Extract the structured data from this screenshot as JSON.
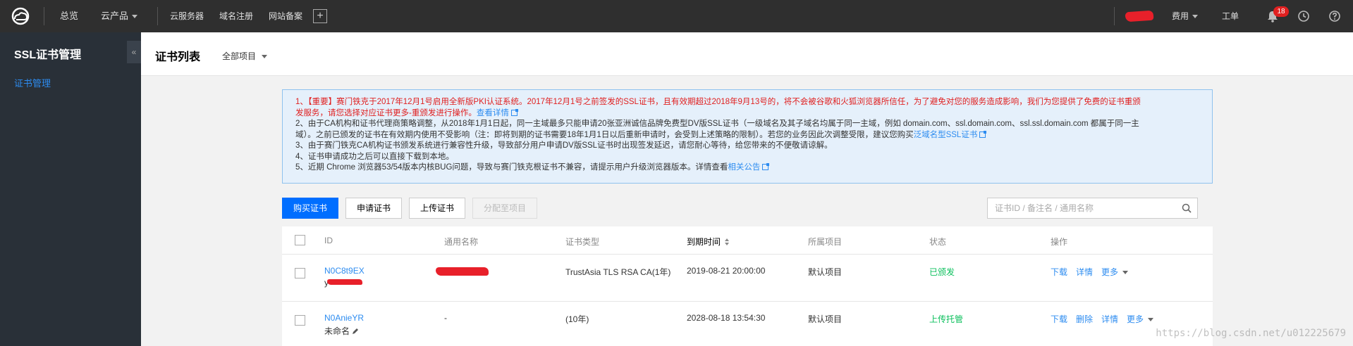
{
  "topbar": {
    "nav": {
      "overview": "总览",
      "products": "云产品",
      "cvm": "云服务器",
      "domain": "域名注册",
      "icp": "网站备案",
      "add": "+"
    },
    "right": {
      "billing": "费用",
      "tickets": "工单",
      "notification_count": "18"
    }
  },
  "sidebar": {
    "title": "SSL证书管理",
    "collapse": "«",
    "items": [
      {
        "label": "证书管理"
      }
    ]
  },
  "header": {
    "title": "证书列表",
    "project_select": "全部项目"
  },
  "notice": {
    "item1_text": "1、【重要】赛门铁克于2017年12月1号启用全新版PKI认证系统。2017年12月1号之前签发的SSL证书，且有效期超过2018年9月13号的，将不会被谷歌和火狐浏览器所信任，为了避免对您的服务造成影响，我们为您提供了免费的证书重颁",
    "item1_text2": "发服务，请您选择对应证书更多-重颁发进行操作。",
    "item1_link": "查看详情",
    "item2_text": "2、由于CA机构和证书代理商策略调整，从2018年1月1日起，同一主域最多只能申请20张亚洲诚信品牌免费型DV版SSL证书（一级域名及其子域名均属于同一主域，例如 domain.com、ssl.domain.com、ssl.ssl.domain.com 都属于同一主",
    "item2_text2": "域）。之前已颁发的证书在有效期内使用不受影响（注：即将到期的证书需要18年1月1日以后重新申请时，会受到上述策略的限制）。若您的业务因此次调整受限，建议您购买",
    "item2_link": "泛域名型SSL证书",
    "item3_text": "3、由于赛门铁克CA机构证书颁发系统进行兼容性升级，导致部分用户申请DV版SSL证书时出现签发延迟，请您耐心等待，给您带来的不便敬请谅解。",
    "item4_text": "4、证书申请成功之后可以直接下载到本地。",
    "item5_text": "5、近期 Chrome 浏览器53/54版本内核BUG问题，导致与赛门铁克根证书不兼容，请提示用户升级浏览器版本。详情查看",
    "item5_link": "相关公告"
  },
  "toolbar": {
    "buy": "购买证书",
    "apply": "申请证书",
    "upload": "上传证书",
    "assign": "分配至项目",
    "search_placeholder": "证书ID / 备注名 / 通用名称"
  },
  "table": {
    "headers": {
      "id": "ID",
      "common_name": "通用名称",
      "type": "证书类型",
      "expire": "到期时间",
      "project": "所属项目",
      "status": "状态",
      "actions": "操作"
    },
    "rows": [
      {
        "id": "N0C8t9EX",
        "remark": "y",
        "common_name": "",
        "type": "TrustAsia TLS RSA CA(1年)",
        "expire": "2019-08-21 20:00:00",
        "project": "默认项目",
        "status": "已颁发",
        "actions": [
          "下载",
          "详情",
          "更多"
        ]
      },
      {
        "id": "N0AnieYR",
        "remark": "未命名",
        "common_name": "-",
        "type": "(10年)",
        "expire": "2028-08-18 13:54:30",
        "project": "默认项目",
        "status": "上传托管",
        "actions": [
          "下载",
          "删除",
          "详情",
          "更多"
        ]
      }
    ]
  },
  "watermark": "https://blog.csdn.net/u012225679",
  "colors": {
    "topbar_bg": "#2f2f2f",
    "sidebar_bg": "#293038",
    "accent": "#006eff",
    "link": "#2d8cf0",
    "success": "#0abf5b",
    "warning_text": "#e02020"
  }
}
